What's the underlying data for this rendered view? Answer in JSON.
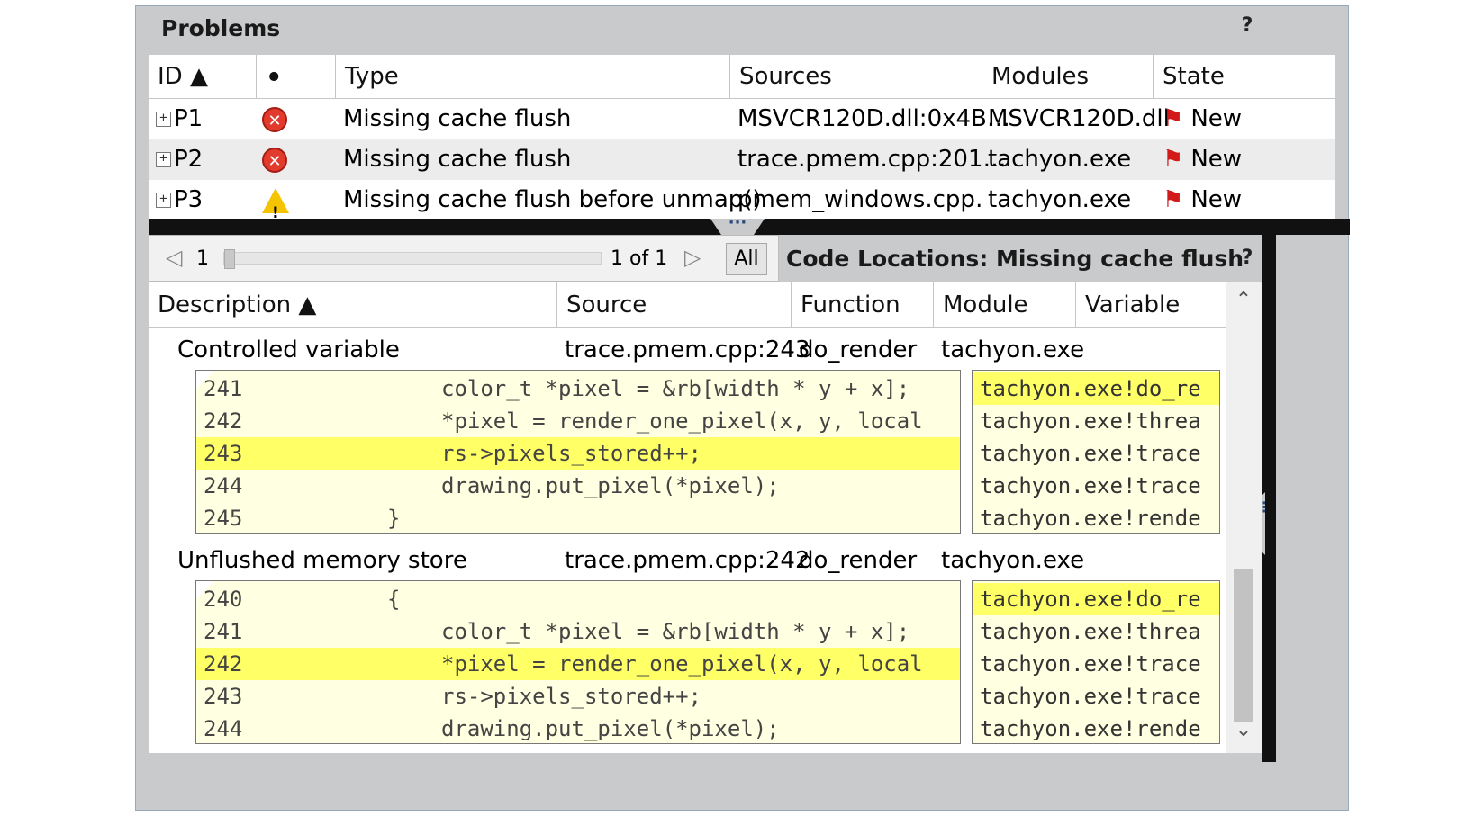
{
  "problems": {
    "title": "Problems",
    "help_icon": "help-icon",
    "columns": [
      "ID ▲",
      "",
      "Type",
      "Sources",
      "Modules",
      "State"
    ],
    "rows": [
      {
        "id": "P1",
        "severity": "error",
        "type": "Missing cache flush",
        "sources": "MSVCR120D.dll:0x4B…",
        "modules": "MSVCR120D.dll",
        "state": "New"
      },
      {
        "id": "P2",
        "severity": "error",
        "type": "Missing cache flush",
        "sources": "trace.pmem.cpp:201…",
        "modules": "tachyon.exe",
        "state": "New"
      },
      {
        "id": "P3",
        "severity": "warning",
        "type": "Missing cache flush before unmap()",
        "sources": "pmem_windows.cpp…",
        "modules": "tachyon.exe",
        "state": "New"
      }
    ]
  },
  "navigator": {
    "current": "1",
    "position": "1 of 1",
    "all_label": "All"
  },
  "code_locations": {
    "title": "Code Locations: Missing cache flush",
    "columns": [
      "Description ▲",
      "Source",
      "Function",
      "Module",
      "Variable"
    ],
    "observations": [
      {
        "description": "Controlled variable",
        "source": "trace.pmem.cpp:243",
        "function": "do_render",
        "module": "tachyon.exe",
        "variable": "",
        "code": [
          {
            "ln": "241",
            "text": "color_t *pixel = &rb[width * y + x];",
            "indent": 0
          },
          {
            "ln": "242",
            "text": "*pixel = render_one_pixel(x, y, local",
            "indent": 0
          },
          {
            "ln": "243",
            "text": "rs->pixels_stored++;",
            "indent": 0,
            "highlight": true
          },
          {
            "ln": "244",
            "text": "drawing.put_pixel(*pixel);",
            "indent": 0
          },
          {
            "ln": "245",
            "text": "}",
            "indent": -1
          }
        ],
        "stack": [
          {
            "text": "tachyon.exe!do_re",
            "highlight": true
          },
          {
            "text": "tachyon.exe!threa"
          },
          {
            "text": "tachyon.exe!trace"
          },
          {
            "text": "tachyon.exe!trace"
          },
          {
            "text": "tachyon.exe!rende"
          }
        ]
      },
      {
        "description": "Unflushed memory store",
        "source": "trace.pmem.cpp:242",
        "function": "do_render",
        "module": "tachyon.exe",
        "variable": "",
        "code": [
          {
            "ln": "240",
            "text": "{",
            "indent": -1
          },
          {
            "ln": "241",
            "text": "color_t *pixel = &rb[width * y + x];",
            "indent": 0
          },
          {
            "ln": "242",
            "text": "*pixel = render_one_pixel(x, y, local",
            "indent": 0,
            "highlight": true
          },
          {
            "ln": "243",
            "text": "rs->pixels_stored++;",
            "indent": 0
          },
          {
            "ln": "244",
            "text": "drawing.put_pixel(*pixel);",
            "indent": 0
          }
        ],
        "stack": [
          {
            "text": "tachyon.exe!do_re",
            "highlight": true
          },
          {
            "text": "tachyon.exe!threa"
          },
          {
            "text": "tachyon.exe!trace"
          },
          {
            "text": "tachyon.exe!trace"
          },
          {
            "text": "tachyon.exe!rende"
          }
        ]
      }
    ]
  }
}
